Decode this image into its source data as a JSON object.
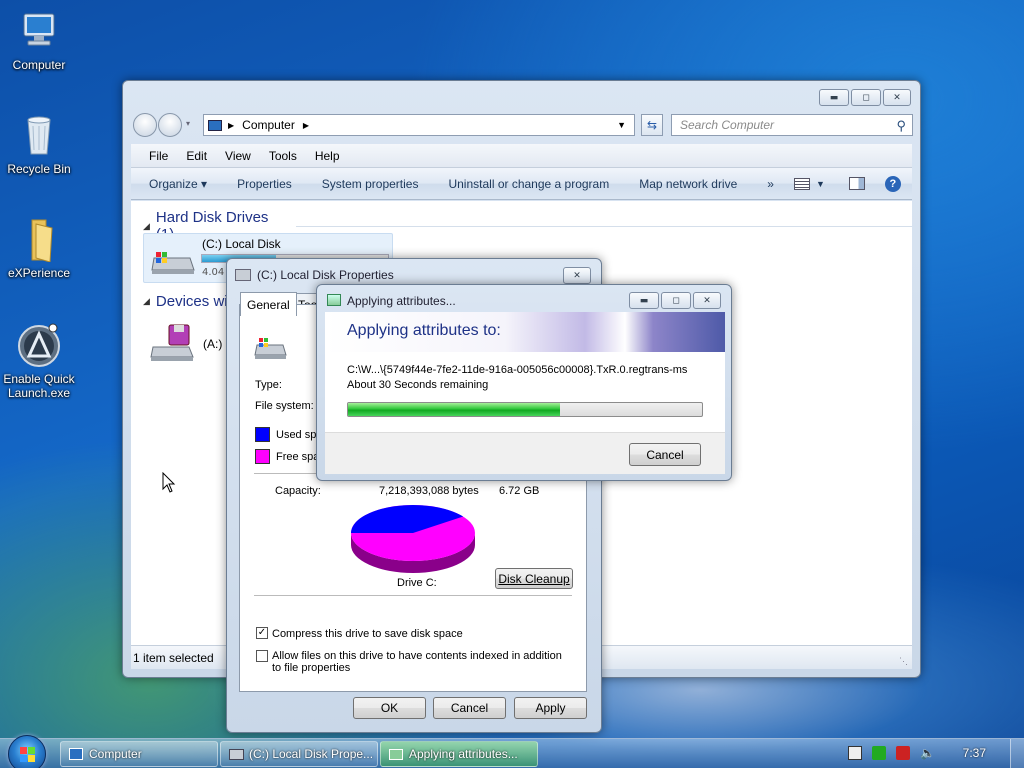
{
  "desktop": {
    "icons": [
      {
        "label": "Computer"
      },
      {
        "label": "Recycle Bin"
      },
      {
        "label": "eXPerience"
      },
      {
        "label": "Enable Quick Launch.exe"
      }
    ]
  },
  "explorer": {
    "breadcrumb": "Computer",
    "search_placeholder": "Search Computer",
    "menu": [
      "File",
      "Edit",
      "View",
      "Tools",
      "Help"
    ],
    "commands": [
      "Organize ▾",
      "Properties",
      "System properties",
      "Uninstall or change a program",
      "Map network drive",
      "»"
    ],
    "groups": {
      "hard_disk": "Hard Disk Drives (1)",
      "devices": "Devices wit"
    },
    "drive_c": {
      "name": "(C:) Local Disk",
      "free_text": "4.04",
      "fill_fraction": 0.4
    },
    "drive_a": {
      "name": "(A:)"
    },
    "status": "1 item selected"
  },
  "properties": {
    "title": "(C:) Local Disk Properties",
    "tabs": [
      "General",
      "Tool"
    ],
    "type_label": "Type:",
    "fs_label": "File system:",
    "used_label": "Used spa",
    "free_label": "Free spa",
    "used_color": "#0000ff",
    "free_color": "#ff00ff",
    "capacity_label": "Capacity:",
    "capacity_bytes": "7,218,393,088 bytes",
    "capacity_gb": "6.72 GB",
    "drive_label": "Drive C:",
    "disk_cleanup": "Disk Cleanup",
    "compress_label": "Compress this drive to save disk space",
    "compress_checked": true,
    "index_label": "Allow files on this drive to have contents indexed in addition to file properties",
    "ok": "OK",
    "cancel": "Cancel",
    "apply": "Apply",
    "close_glyph": "✕",
    "pie_used_fraction": 0.4
  },
  "applying": {
    "title": "Applying attributes...",
    "heading": "Applying attributes to:",
    "path": "C:\\W...\\{5749f44e-7fe2-11de-916a-005056c00008}.TxR.0.regtrans-ms",
    "remaining": "About 30 Seconds remaining",
    "progress": 0.6,
    "cancel": "Cancel"
  },
  "taskbar": {
    "tasks": [
      "Computer",
      "(C:) Local Disk Prope...",
      "Applying attributes..."
    ],
    "clock": "7:37"
  }
}
